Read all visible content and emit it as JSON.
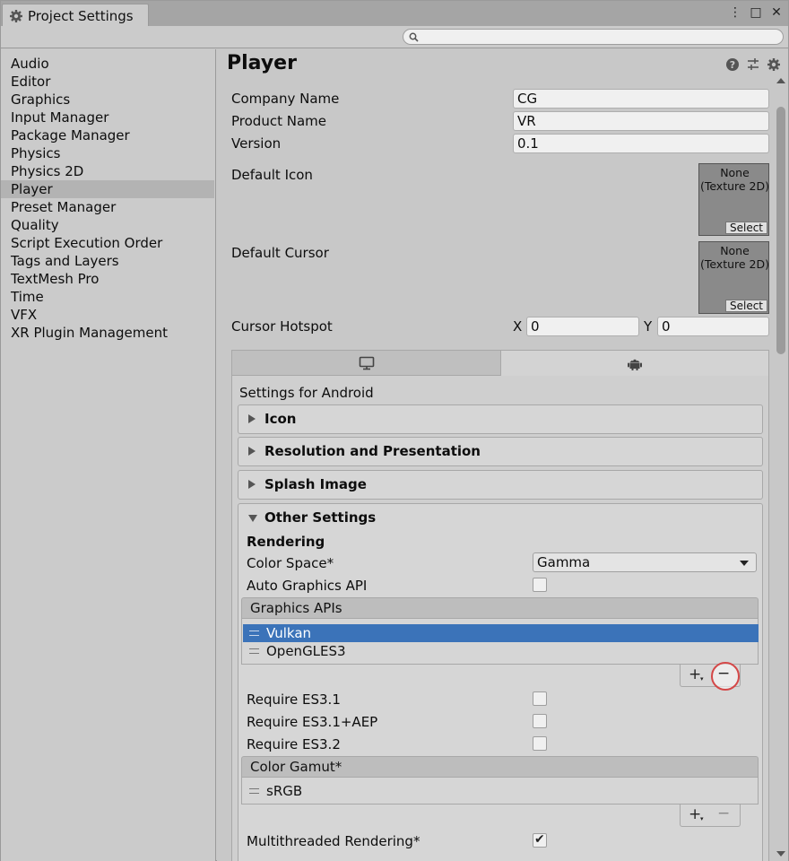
{
  "window": {
    "tab_title": "Project Settings",
    "controls": {
      "menu": "⋮",
      "maximize": "□",
      "close": "✕"
    }
  },
  "search": {
    "placeholder": "",
    "value": ""
  },
  "sidebar": {
    "selected": "Player",
    "items": [
      {
        "label": "Audio"
      },
      {
        "label": "Editor"
      },
      {
        "label": "Graphics"
      },
      {
        "label": "Input Manager"
      },
      {
        "label": "Package Manager"
      },
      {
        "label": "Physics"
      },
      {
        "label": "Physics 2D"
      },
      {
        "label": "Player"
      },
      {
        "label": "Preset Manager"
      },
      {
        "label": "Quality"
      },
      {
        "label": "Script Execution Order"
      },
      {
        "label": "Tags and Layers"
      },
      {
        "label": "TextMesh Pro"
      },
      {
        "label": "Time"
      },
      {
        "label": "VFX"
      },
      {
        "label": "XR Plugin Management"
      }
    ]
  },
  "player": {
    "title": "Player",
    "company_name": {
      "label": "Company Name",
      "value": "CG"
    },
    "product_name": {
      "label": "Product Name",
      "value": "VR"
    },
    "version": {
      "label": "Version",
      "value": "0.1"
    },
    "default_icon": {
      "label": "Default Icon",
      "slot_text": "None\n(Texture 2D)",
      "select_label": "Select"
    },
    "default_cursor": {
      "label": "Default Cursor",
      "slot_text": "None\n(Texture 2D)",
      "select_label": "Select"
    },
    "cursor_hotspot": {
      "label": "Cursor Hotspot",
      "x_label": "X",
      "x_value": "0",
      "y_label": "Y",
      "y_value": "0"
    }
  },
  "platform": {
    "tabs": [
      {
        "icon": "monitor-icon",
        "active": false
      },
      {
        "icon": "android-icon",
        "active": true
      }
    ],
    "settings_for": "Settings for Android",
    "sections": [
      {
        "label": "Icon"
      },
      {
        "label": "Resolution and Presentation"
      },
      {
        "label": "Splash Image"
      }
    ],
    "other": {
      "label": "Other Settings",
      "rendering_label": "Rendering",
      "color_space": {
        "label": "Color Space*",
        "value": "Gamma"
      },
      "auto_graphics_api": {
        "label": "Auto Graphics API",
        "checked": false
      },
      "graphics_apis": {
        "header": "Graphics APIs",
        "items": [
          "Vulkan",
          "OpenGLES3"
        ],
        "selected": "Vulkan"
      },
      "require_es31": {
        "label": "Require ES3.1",
        "checked": false
      },
      "require_es31_aep": {
        "label": "Require ES3.1+AEP",
        "checked": false
      },
      "require_es32": {
        "label": "Require ES3.2",
        "checked": false
      },
      "color_gamut": {
        "header": "Color Gamut*",
        "items": [
          "sRGB"
        ]
      },
      "multithreaded": {
        "label": "Multithreaded Rendering*",
        "checked": true
      }
    },
    "list_buttons": {
      "plus": "+",
      "plus_caret": "▾",
      "minus": "−"
    }
  },
  "colors": {
    "selection": "#3b73b9",
    "highlight_ring": "#d44848"
  }
}
